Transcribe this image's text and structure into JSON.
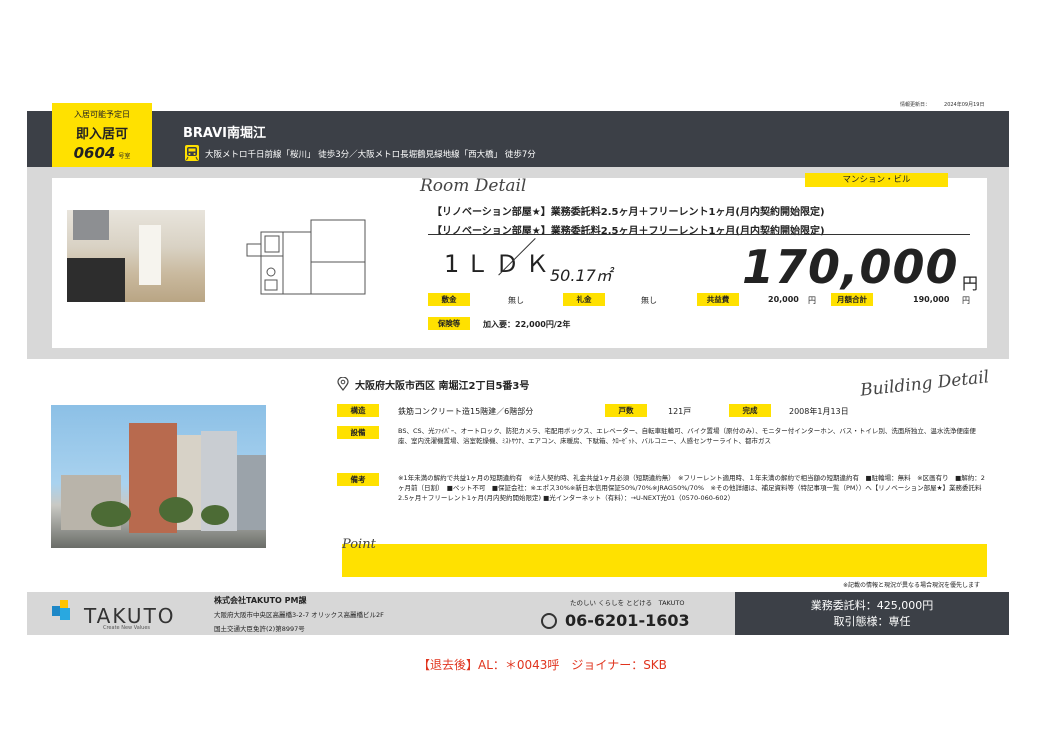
{
  "update": {
    "label": "情報更新日：",
    "date": "2024年09月19日"
  },
  "tag": {
    "label": "入居可能予定日",
    "status": "即入居可",
    "room": "0604",
    "room_suffix": "号室"
  },
  "building_name": "BRAVI南堀江",
  "stations": "大阪メトロ千日前線「桜川」 徒歩3分／大阪メトロ長堀鶴見緑地線「西大橋」 徒歩7分",
  "room_detail": {
    "heading": "Room Detail",
    "property_type": "マンション・ビル",
    "headline1": "【リノベーション部屋★】業務委託料2.5ヶ月＋フリーレント1ヶ月(月内契約開始限定)",
    "headline2": "【リノベーション部屋★】業務委託料2.5ヶ月＋フリーレント1ヶ月(月内契約開始限定)",
    "layout": "1ＬＤＫ",
    "area": "50.17㎡",
    "rent": "170,000",
    "rent_unit": "円",
    "deposit_label": "敷金",
    "deposit": "無し",
    "key_money_label": "礼金",
    "key_money": "無し",
    "common_fee_label": "共益費",
    "common_fee": "20,000",
    "common_fee_unit": "円",
    "monthly_total_label": "月額合計",
    "monthly_total": "190,000",
    "monthly_total_unit": "円",
    "insurance_label": "保険等",
    "insurance": "加入要：22,000円/2年"
  },
  "building_detail": {
    "heading": "Building Detail",
    "address": "大阪府大阪市西区 南堀江2丁目5番3号",
    "structure_label": "構造",
    "structure": "鉄筋コンクリート造15階建／6階部分",
    "units_label": "戸数",
    "units": "121戸",
    "completed_label": "完成",
    "completed": "2008年1月13日",
    "facilities_label": "設備",
    "facilities": "BS、CS、光ﾌｧｲﾊﾞｰ、オートロック、防犯カメラ、宅配用ボックス、エレベーター、自転車駐輪可、バイク置場（原付のみ）、モニター付インターホン、バス・トイレ別、洗面所独立、温水洗浄便座便座、室内洗濯機置場、浴室乾燥機、ﾐｽﾄｻｳﾅ、エアコン、床暖房、下駄箱、ｸﾛｰｾﾞｯﾄ、バルコニー、人感センサーライト、都市ガス",
    "remarks_label": "備考",
    "remarks": "※1年未満の解約で共益1ヶ月の短期違約有　※法人契約時、礼金共益1ヶ月必須（短期違約無）　※フリーレント適用時、１年未満の解約で相当額の短期違約有　■駐輪場：無料　※区画有り　■解約：2ヶ月前（日割）　■ペット不可　■保証会社：※エポス30%※新日本信用保証50%/70%※JRAG50%/70%　※その他詳細は、補足資料等（特記事項一覧（PM））へ【リノベーション部屋★】業務委託料2.5ヶ月＋フリーレント1ヶ月(月内契約開始限定) ■光インターネット（有料）：→U-NEXT光01（0570-060-602）"
  },
  "point": {
    "heading": "Point"
  },
  "disclaimer": "※記載の情報と現況が異なる場合現況を優先します",
  "footer": {
    "logo_word": "TAKUTO",
    "logo_tagline": "Create New Values",
    "company": "株式会社TAKUTO PM課",
    "address": "大阪府大阪市中央区高麗橋3-2-7 オリックス高麗橋ビル2F",
    "license": "国土交通大臣免許(2)第8997号",
    "slogan": "たのしい くらしを とどける　TAKUTO",
    "phone": "06-6201-1603",
    "fee": "業務委託料：425,000円",
    "transaction": "取引態様：専任"
  },
  "bottom_note": "【退去後】AL：＊0043呼　ジョイナー：SKB",
  "colors": {
    "accent": "#ffe100",
    "dark": "#3c4047",
    "note_red": "#e0341e"
  }
}
